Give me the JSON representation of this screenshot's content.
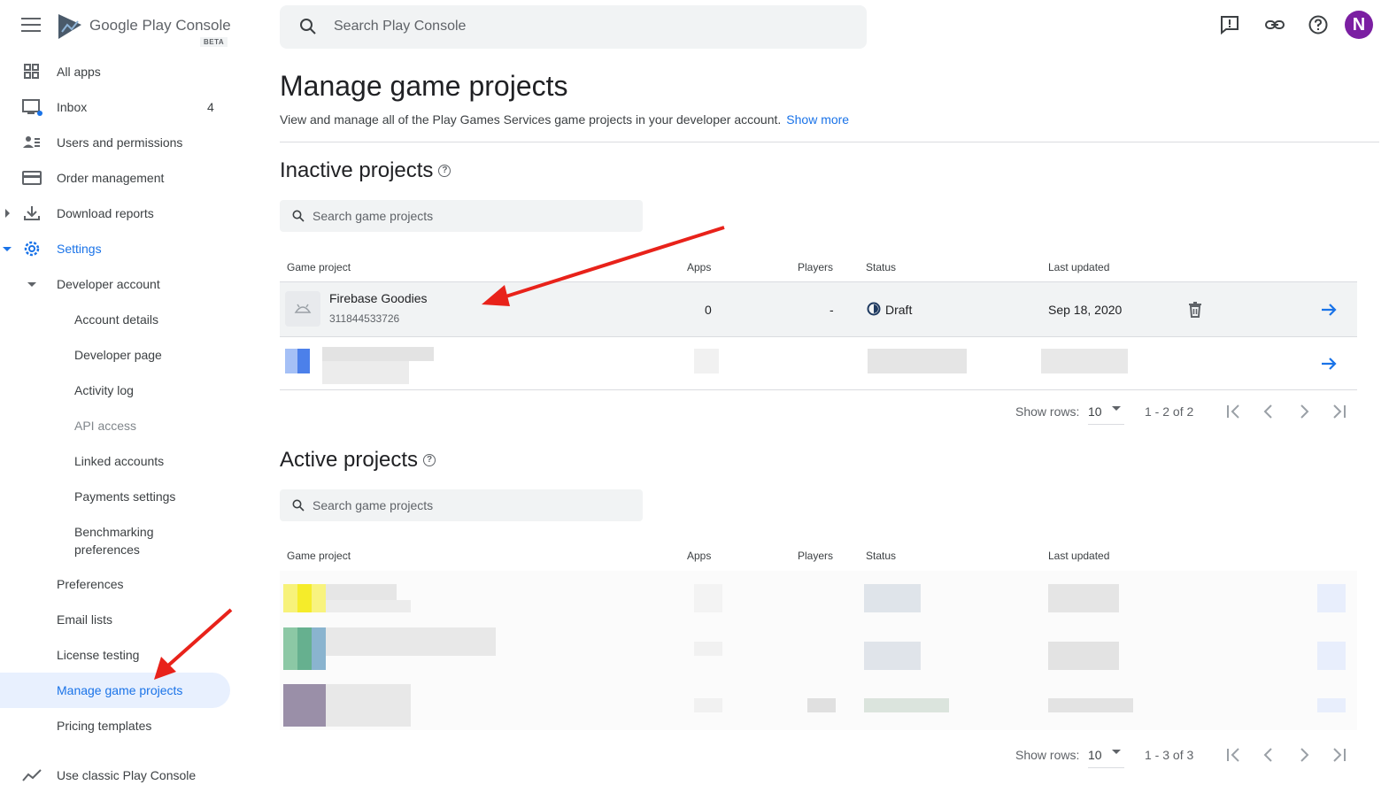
{
  "app": {
    "logo_text": "Google Play Console",
    "beta": "BETA"
  },
  "search": {
    "placeholder": "Search Play Console"
  },
  "user": {
    "initial": "N"
  },
  "sidebar": {
    "items": [
      {
        "label": "All apps",
        "icon": "grid-icon"
      },
      {
        "label": "Inbox",
        "count": "4",
        "icon": "inbox-icon"
      },
      {
        "label": "Users and permissions",
        "icon": "users-icon"
      },
      {
        "label": "Order management",
        "icon": "card-icon"
      },
      {
        "label": "Download reports",
        "icon": "download-icon"
      },
      {
        "label": "Settings",
        "icon": "gear-icon"
      },
      {
        "label": "Developer account"
      },
      {
        "label": "Account details"
      },
      {
        "label": "Developer page"
      },
      {
        "label": "Activity log"
      },
      {
        "label": "API access"
      },
      {
        "label": "Linked accounts"
      },
      {
        "label": "Payments settings"
      },
      {
        "label": "Benchmarking preferences"
      },
      {
        "label": "Preferences"
      },
      {
        "label": "Email lists"
      },
      {
        "label": "License testing"
      },
      {
        "label": "Manage game projects"
      },
      {
        "label": "Pricing templates"
      },
      {
        "label": "Use classic Play Console",
        "icon": "trend-icon"
      }
    ]
  },
  "main": {
    "title": "Manage game projects",
    "description": "View and manage all of the Play Games Services game projects in your developer account.",
    "show_more": "Show more",
    "inactive": {
      "title": "Inactive projects",
      "search_placeholder": "Search game projects",
      "headers": [
        "Game project",
        "Apps",
        "Players",
        "Status",
        "Last updated"
      ],
      "rows": [
        {
          "name": "Firebase Goodies",
          "id": "311844533726",
          "apps": "0",
          "players": "-",
          "status": "Draft",
          "last_updated": "Sep 18, 2020"
        }
      ],
      "pager": {
        "show_rows": "Show rows:",
        "rows": "10",
        "range": "1 - 2 of 2"
      }
    },
    "active": {
      "title": "Active projects",
      "search_placeholder": "Search game projects",
      "headers": [
        "Game project",
        "Apps",
        "Players",
        "Status",
        "Last updated"
      ],
      "pager": {
        "show_rows": "Show rows:",
        "rows": "10",
        "range": "1 - 3 of 3"
      }
    }
  },
  "colors": {
    "accent": "#1a73e8",
    "annotation": "#e8221a"
  }
}
